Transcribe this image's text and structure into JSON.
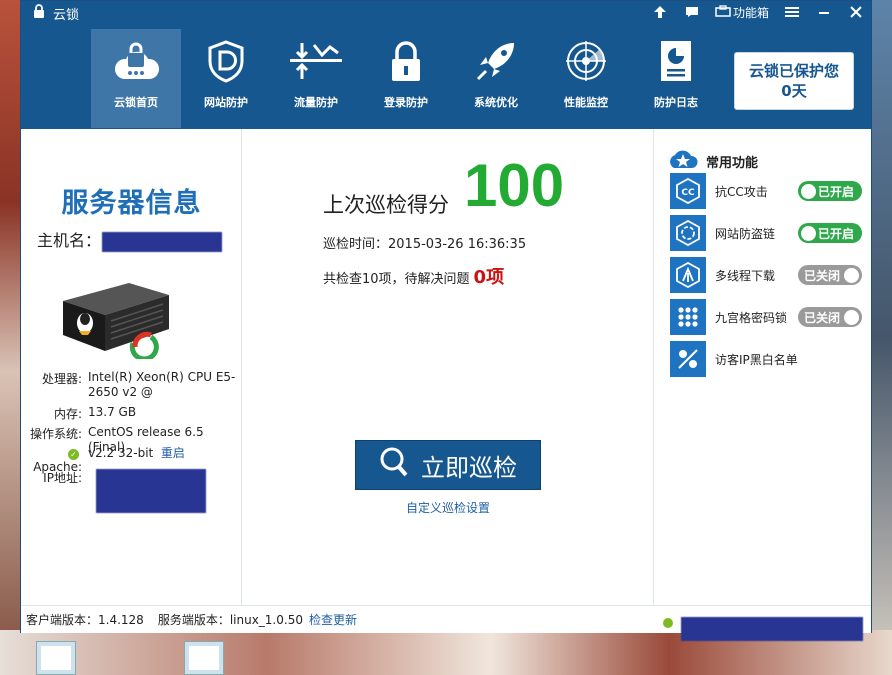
{
  "app": {
    "title": "云锁"
  },
  "titlebar": {
    "toolbox_label": "功能箱"
  },
  "nav": {
    "items": [
      {
        "label": "云锁首页",
        "icon": "cloud-lock-icon",
        "active": true
      },
      {
        "label": "网站防护",
        "icon": "shield-d-icon"
      },
      {
        "label": "流量防护",
        "icon": "traffic-icon"
      },
      {
        "label": "登录防护",
        "icon": "lock-icon"
      },
      {
        "label": "系统优化",
        "icon": "rocket-icon"
      },
      {
        "label": "性能监控",
        "icon": "radar-icon"
      },
      {
        "label": "防护日志",
        "icon": "report-icon"
      }
    ]
  },
  "protect": {
    "line1": "云锁已保护您",
    "line2": "0天"
  },
  "server": {
    "title": "服务器信息",
    "hostname_label": "主机名：",
    "cpu_label": "处理器:",
    "cpu_value": "Intel(R) Xeon(R) CPU E5-2650 v2 @",
    "mem_label": "内存:",
    "mem_value": "13.7 GB",
    "os_label": "操作系统:",
    "os_value": "CentOS release 6.5 (Final)",
    "apache_label": "Apache:",
    "apache_value": "v2.2 32-bit",
    "restart_label": "重启",
    "ip_label": "IP地址:"
  },
  "scan": {
    "score_label": "上次巡检得分",
    "score": "100",
    "time_label": "巡检时间：",
    "time_value": "2015-03-26 16:36:35",
    "summary_prefix": "共检查10项，待解决问题",
    "issues": "0项",
    "button_label": "立即巡检",
    "settings_link": "自定义巡检设置"
  },
  "functions": {
    "title": "常用功能",
    "items": [
      {
        "name": "抗CC攻击",
        "state": "已开启",
        "icon": "cc-icon"
      },
      {
        "name": "网站防盗链",
        "state": "已开启",
        "icon": "link-guard-icon"
      },
      {
        "name": "多线程下载",
        "state": "已关闭",
        "icon": "multithread-icon"
      },
      {
        "name": "九宫格密码锁",
        "state": "已关闭",
        "icon": "grid-lock-icon"
      },
      {
        "name": "访客IP黑白名单",
        "icon": "ip-list-icon"
      }
    ]
  },
  "status": {
    "client_version": "客户端版本：1.4.128",
    "server_version": "服务端版本：linux_1.0.50",
    "check_update": "检查更新"
  },
  "colors": {
    "brand": "#17578f",
    "score": "#22aa33",
    "issues": "#cc1111",
    "on": "#2ea84a",
    "off": "#9a9a9a"
  }
}
